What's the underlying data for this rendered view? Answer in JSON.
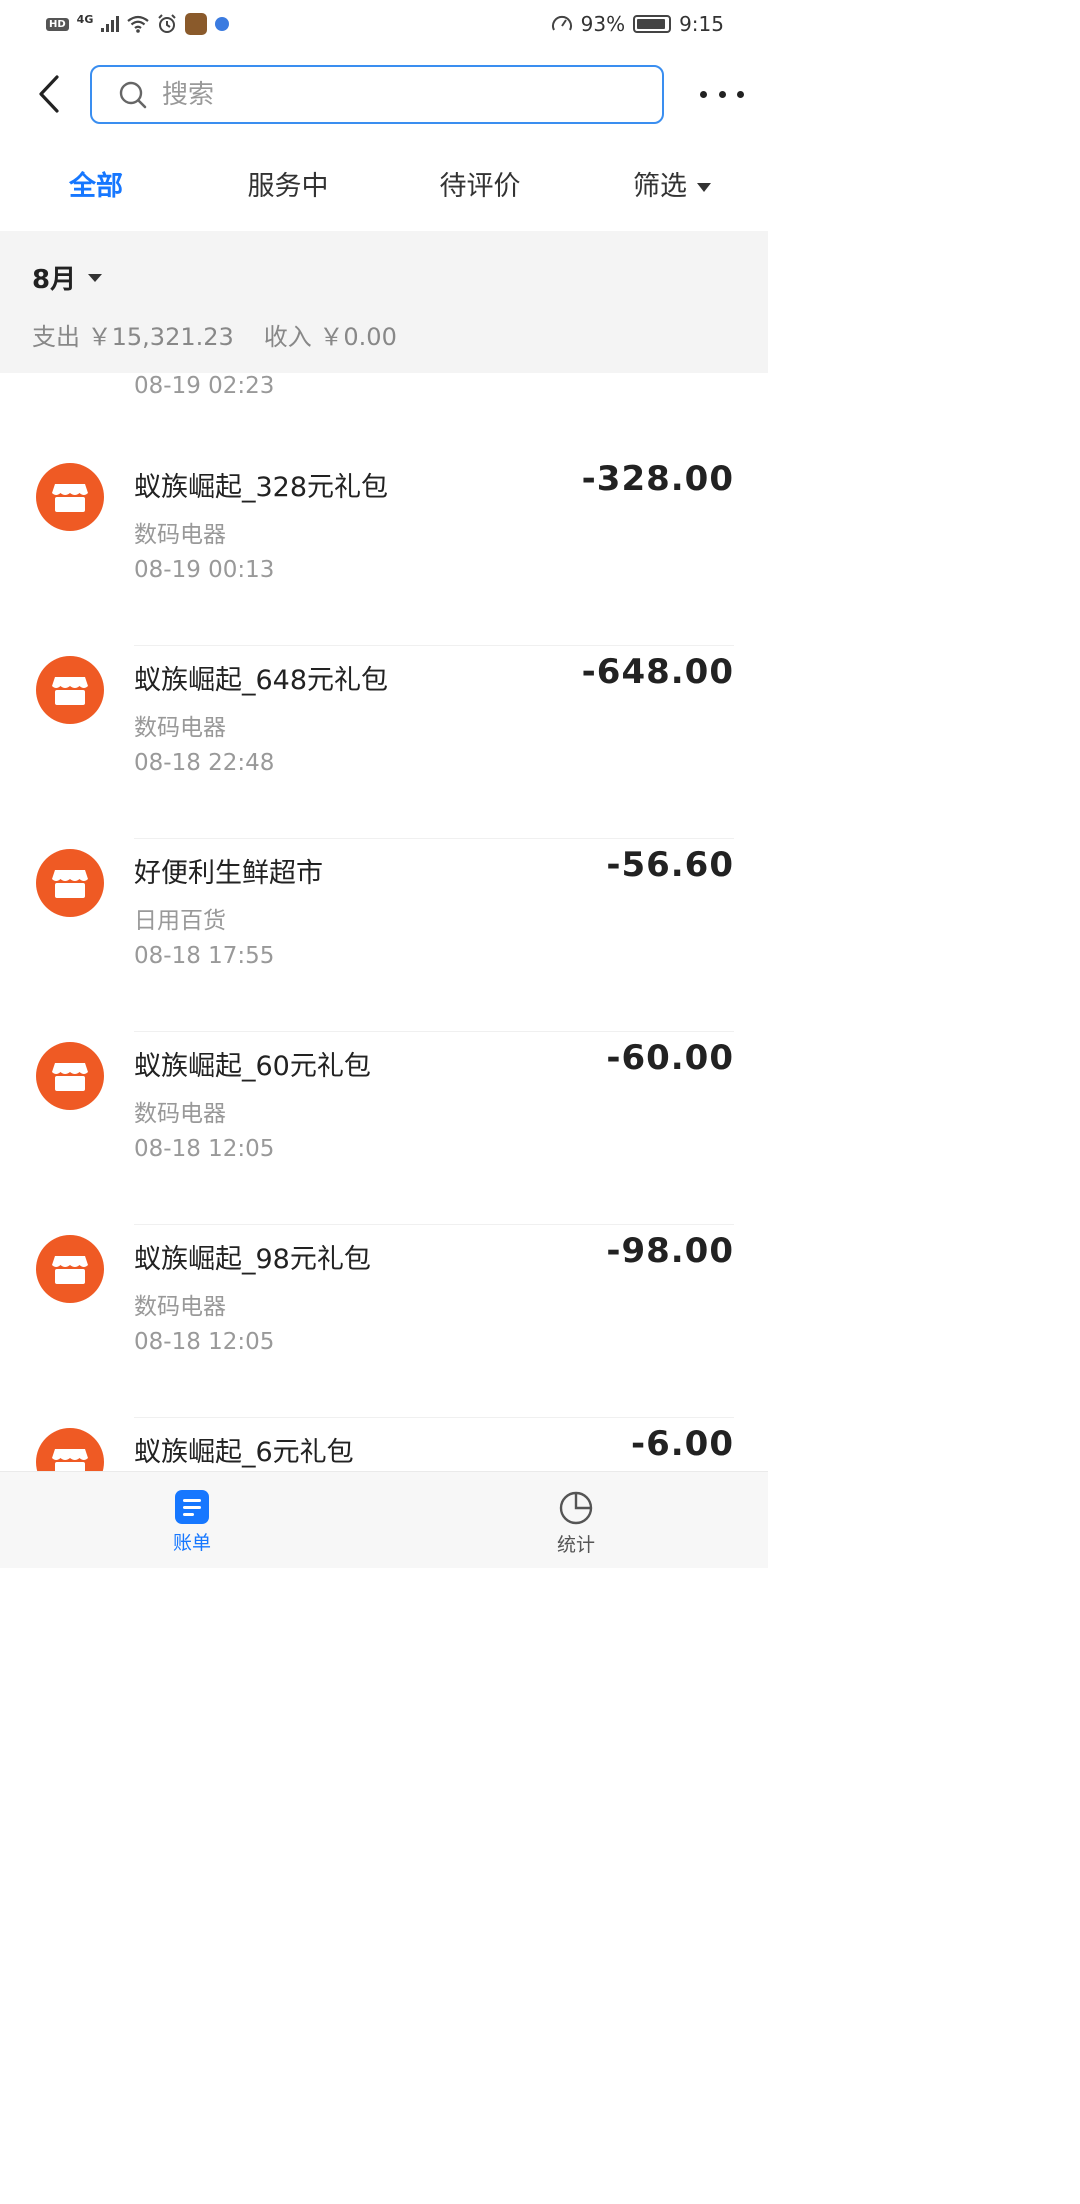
{
  "status_bar": {
    "hd": "HD",
    "network": "4G",
    "battery_percent": "93%",
    "time": "9:15"
  },
  "header": {
    "search_placeholder": "搜索"
  },
  "tabs": [
    {
      "label": "全部",
      "active": true
    },
    {
      "label": "服务中",
      "active": false
    },
    {
      "label": "待评价",
      "active": false
    },
    {
      "label": "筛选",
      "active": false
    }
  ],
  "month": {
    "label": "8月",
    "expense": "支出 ￥15,321.23",
    "income": "收入 ￥0.00"
  },
  "partial_item_time": "08-19  02:23",
  "transactions": [
    {
      "name": "蚁族崛起_328元礼包",
      "category": "数码电器",
      "time": "08-19  00:13",
      "amount": "-328.00"
    },
    {
      "name": "蚁族崛起_648元礼包",
      "category": "数码电器",
      "time": "08-18  22:48",
      "amount": "-648.00"
    },
    {
      "name": "好便利生鲜超市",
      "category": "日用百货",
      "time": "08-18  17:55",
      "amount": "-56.60"
    },
    {
      "name": "蚁族崛起_60元礼包",
      "category": "数码电器",
      "time": "08-18  12:05",
      "amount": "-60.00"
    },
    {
      "name": "蚁族崛起_98元礼包",
      "category": "数码电器",
      "time": "08-18  12:05",
      "amount": "-98.00"
    },
    {
      "name": "蚁族崛起_6元礼包",
      "category": "",
      "time": "",
      "amount": "-6.00"
    }
  ],
  "bottom_nav": [
    {
      "label": "账单",
      "active": true,
      "icon": "bill-icon"
    },
    {
      "label": "统计",
      "active": false,
      "icon": "pie-chart-icon"
    }
  ],
  "colors": {
    "accent": "#1677ff",
    "merchant_avatar": "#ef5a24",
    "muted_text": "#999999",
    "section_bg": "#f4f4f4"
  }
}
